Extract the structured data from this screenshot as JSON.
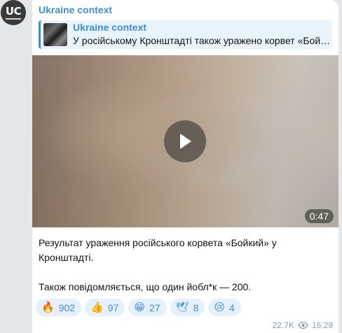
{
  "avatar": {
    "initials": "UC"
  },
  "post": {
    "channel_name": "Ukraine context",
    "forwarded": {
      "title": "Ukraine context",
      "text": "У російському Кронштадті також уражено корвет «Бойкий»"
    },
    "video": {
      "duration": "0:47"
    },
    "message_lines": [
      "Результат ураження російського корвета «Бойкий» у",
      "Кронштадті.",
      "Також повідомляється, що один йобл*к — 200."
    ],
    "reactions": [
      {
        "emoji": "🔥",
        "icon": "fire-icon",
        "count": "902"
      },
      {
        "emoji": "👍",
        "icon": "thumbs-up-icon",
        "count": "97"
      },
      {
        "emoji": "😁",
        "icon": "grin-icon",
        "count": "27"
      },
      {
        "emoji": "🕊",
        "icon": "dove-icon",
        "count": "8"
      },
      {
        "emoji": "😢",
        "icon": "crying-face-icon",
        "count": "4"
      }
    ],
    "views": "22.7K",
    "time": "16:29"
  },
  "colors": {
    "accent": "#3d8dd4",
    "reaction_bg": "#e5f0fb",
    "background": "#e4e7ea"
  }
}
